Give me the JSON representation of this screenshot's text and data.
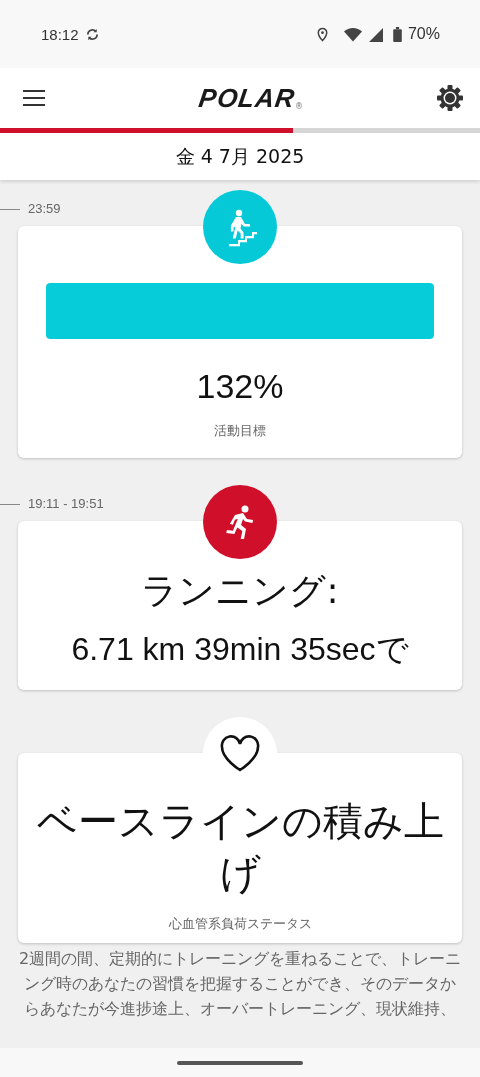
{
  "status_bar": {
    "time": "18:12",
    "battery": "70%"
  },
  "header": {
    "logo": "POLAR",
    "logo_mark": "®",
    "progress": {
      "level": 0.61
    }
  },
  "date": "金 4 7月 2025",
  "entries": [
    {
      "kind": "activity",
      "time": "23:59",
      "percent": "132%",
      "label": "活動目標",
      "level": 1
    },
    {
      "kind": "training",
      "time": "19:11 - 19:51",
      "title": "ランニング:",
      "detail": "6.71 km 39min 35secで"
    },
    {
      "kind": "status",
      "title": "ベースラインの積み上げ",
      "label": "心血管系負荷ステータス"
    }
  ],
  "description": "2週間の間、定期的にトレーニングを重ねることで、トレーニング時のあなたの習慣を把握することができ、そのデータからあなたが今進捗途上、オーバートレーニング、現状維持、"
}
